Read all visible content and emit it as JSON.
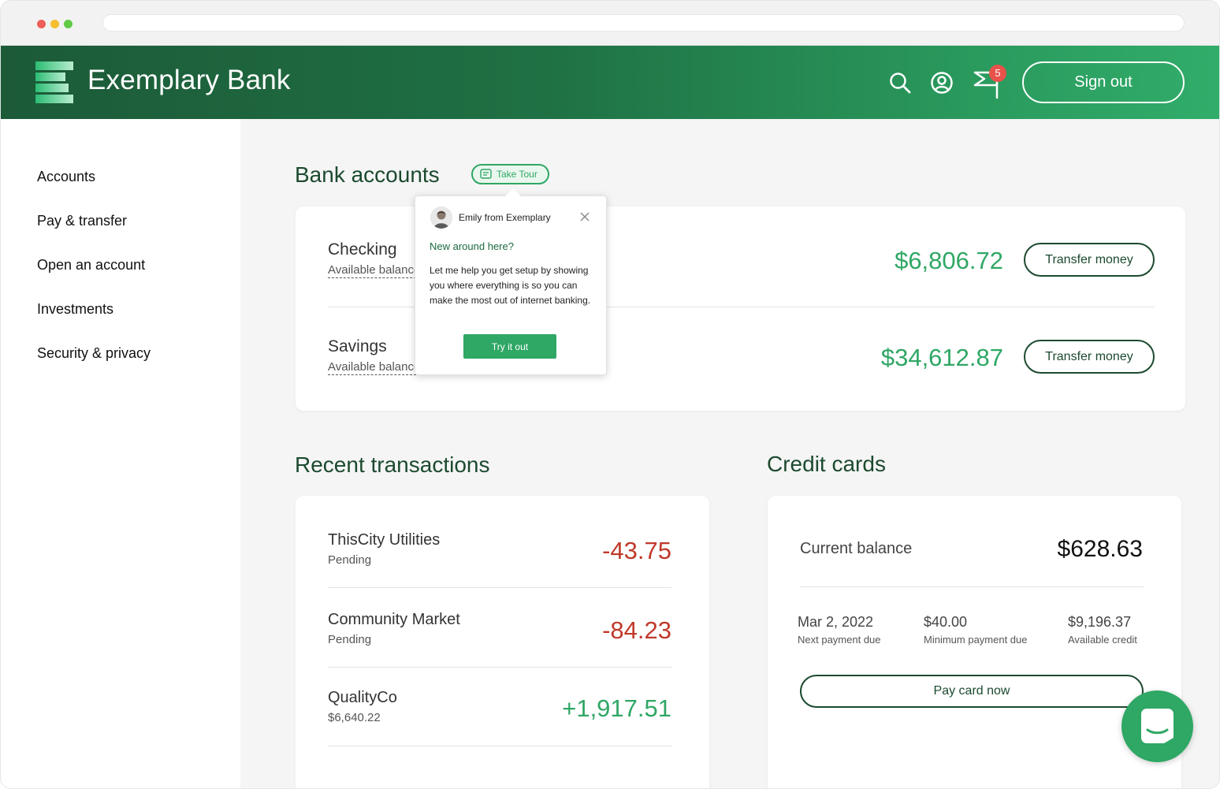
{
  "browser": {
    "url": ""
  },
  "header": {
    "brand": "Exemplary Bank",
    "notification_count": "5",
    "sign_out_label": "Sign out",
    "colors": {
      "header_start": "#1c5a38",
      "header_end": "#31ad6a"
    },
    "icons": [
      "search-icon",
      "user-icon",
      "announcement-icon"
    ]
  },
  "sidebar": {
    "items": [
      {
        "label": "Accounts"
      },
      {
        "label": "Pay & transfer"
      },
      {
        "label": "Open an account"
      },
      {
        "label": "Investments"
      },
      {
        "label": "Security & privacy"
      }
    ]
  },
  "bank_accounts": {
    "title": "Bank accounts",
    "take_tour_label": "Take Tour",
    "accounts": [
      {
        "name": "Checking",
        "sub": "Available balance",
        "amount": "$6,806.72",
        "button": "Transfer money"
      },
      {
        "name": "Savings",
        "sub": "Available balance",
        "amount": "$34,612.87",
        "button": "Transfer money"
      }
    ]
  },
  "tour_popover": {
    "from": "Emily from Exemplary",
    "title": "New around here?",
    "body": "Let me help you get setup by showing you where everything is so you can make the most out of internet banking.",
    "cta": "Try it out"
  },
  "transactions": {
    "title": "Recent transactions",
    "items": [
      {
        "name": "ThisCity Utilities",
        "sub": "Pending",
        "amount": "-43.75",
        "color": "#c0392b"
      },
      {
        "name": "Community Market",
        "sub": "Pending",
        "amount": "-84.23",
        "color": "#c0392b"
      },
      {
        "name": "QualityCo",
        "sub": "$6,640.22",
        "amount": "+1,917.51",
        "color": "#2fa765"
      }
    ]
  },
  "credit_cards": {
    "title": "Credit cards",
    "current_balance_label": "Current balance",
    "current_balance": "$628.63",
    "stats": [
      {
        "value": "Mar 2, 2022",
        "caption": "Next payment due"
      },
      {
        "value": "$40.00",
        "caption": "Minimum payment due"
      },
      {
        "value": "$9,196.37",
        "caption": "Available credit"
      }
    ],
    "pay_label": "Pay card now"
  },
  "colors": {
    "accent": "#2fa765",
    "dark_green": "#1c4a2f",
    "negative": "#c0392b"
  }
}
